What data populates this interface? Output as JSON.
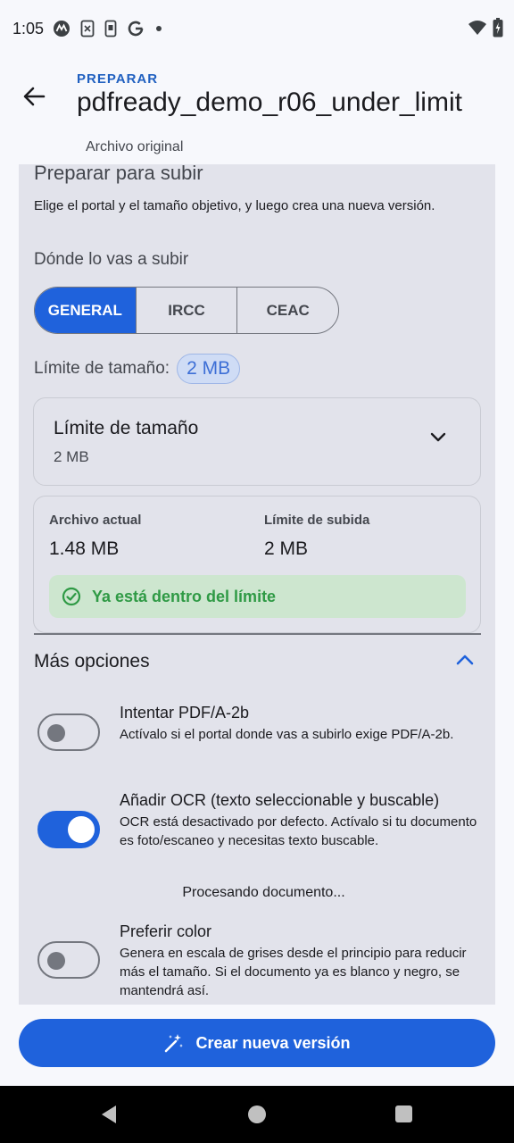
{
  "status_bar": {
    "time": "1:05",
    "icons": [
      "motorola-icon",
      "sim-card-icon",
      "phone-icon",
      "google-icon",
      "dot-icon"
    ],
    "right_icons": [
      "wifi-icon",
      "battery-charging-icon"
    ]
  },
  "header": {
    "overline": "PREPARAR",
    "title": "pdfready_demo_r06_under_limit",
    "subtitle": "Archivo original"
  },
  "prepare": {
    "title": "Preparar para subir",
    "description": "Elige el portal y el tamaño objetivo, y luego crea una nueva versión.",
    "upload_label": "Dónde lo vas a subir",
    "portals": [
      {
        "label": "GENERAL",
        "selected": true
      },
      {
        "label": "IRCC",
        "selected": false
      },
      {
        "label": "CEAC",
        "selected": false
      }
    ],
    "limit_label": "Límite de tamaño:",
    "limit_chip": "2 MB",
    "dropdown": {
      "label": "Límite de tamaño",
      "value": "2 MB"
    },
    "info": {
      "current_label": "Archivo actual",
      "current_value": "1.48 MB",
      "upload_limit_label": "Límite de subida",
      "upload_limit_value": "2 MB",
      "status_text": "Ya está dentro del límite"
    }
  },
  "more_options": {
    "title": "Más opciones",
    "options": [
      {
        "title": "Intentar PDF/A-2b",
        "description": "Actívalo si el portal donde vas a subirlo exige PDF/A-2b.",
        "enabled": false
      },
      {
        "title": "Añadir OCR (texto seleccionable y buscable)",
        "description": "OCR está desactivado por defecto. Actívalo si tu documento es foto/escaneo y necesitas texto buscable.",
        "enabled": true
      },
      {
        "title": "Preferir color",
        "description": "Genera en escala de grises desde el principio para reducir más el tamaño. Si el documento ya es blanco y negro, se mantendrá así.",
        "enabled": false
      }
    ],
    "processing_text": "Procesando documento..."
  },
  "actions": {
    "create_label": "Crear nueva versión"
  },
  "colors": {
    "primary": "#1f62dc",
    "success": "#2f9a45",
    "success_bg": "#cde6cf",
    "card_bg": "#e2e3eb"
  }
}
